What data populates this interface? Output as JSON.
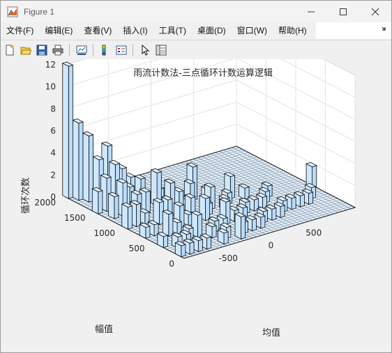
{
  "window": {
    "title": "Figure 1"
  },
  "menu": [
    "文件(F)",
    "编辑(E)",
    "查看(V)",
    "插入(I)",
    "工具(T)",
    "桌面(D)",
    "窗口(W)",
    "帮助(H)"
  ],
  "toolbar": {
    "buttons": [
      {
        "name": "new-figure-icon",
        "icon": "new-figure-icon"
      },
      {
        "name": "open-file-icon",
        "icon": "open-file-icon"
      },
      {
        "name": "save-icon",
        "icon": "save-icon"
      },
      {
        "name": "print-icon",
        "icon": "print-icon"
      },
      {
        "name": "link-plot-icon",
        "icon": "link-plot-icon"
      },
      {
        "name": "colorbar-icon",
        "icon": "colorbar-icon"
      },
      {
        "name": "legend-icon",
        "icon": "legend-icon"
      },
      {
        "name": "edit-plot-arrow-icon",
        "icon": "arrow-icon"
      },
      {
        "name": "property-inspector-icon",
        "icon": "property-inspector-icon"
      }
    ]
  },
  "colors": {
    "bar_face": "#cfe8ff",
    "bar_edge": "#0a0a0a",
    "axes_bg": "#ffffff",
    "grid": "#e3e3e3"
  },
  "chart_data": {
    "type": "bar3",
    "title": "雨流计数法-三点循环计数运算逻辑",
    "xlabel": "均值",
    "ylabel": "幅值",
    "zlabel": "循环次数",
    "xlim": [
      -1000,
      1000
    ],
    "ylim": [
      0,
      2000
    ],
    "zlim": [
      0,
      12
    ],
    "xticks": [
      -500,
      0,
      500
    ],
    "yticks": [
      0,
      500,
      1000,
      1500,
      2000
    ],
    "zticks": [
      0,
      2,
      4,
      6,
      8,
      10,
      12
    ],
    "grid": true,
    "bars": [
      {
        "x": -975,
        "y": 2000,
        "z": 12
      },
      {
        "x": -925,
        "y": 1900,
        "z": 7
      },
      {
        "x": -875,
        "y": 1800,
        "z": 6
      },
      {
        "x": -825,
        "y": 1700,
        "z": 4
      },
      {
        "x": -725,
        "y": 1700,
        "z": 5
      },
      {
        "x": -625,
        "y": 1600,
        "z": 3
      },
      {
        "x": -525,
        "y": 1600,
        "z": 2
      },
      {
        "x": -975,
        "y": 1500,
        "z": 2
      },
      {
        "x": -875,
        "y": 1500,
        "z": 3
      },
      {
        "x": -775,
        "y": 1500,
        "z": 4
      },
      {
        "x": -675,
        "y": 1400,
        "z": 2
      },
      {
        "x": -575,
        "y": 1400,
        "z": 1
      },
      {
        "x": -925,
        "y": 1300,
        "z": 2
      },
      {
        "x": -825,
        "y": 1300,
        "z": 3
      },
      {
        "x": -725,
        "y": 1200,
        "z": 2
      },
      {
        "x": -625,
        "y": 1200,
        "z": 2
      },
      {
        "x": -475,
        "y": 1500,
        "z": 2
      },
      {
        "x": -425,
        "y": 1300,
        "z": 3
      },
      {
        "x": -325,
        "y": 1400,
        "z": 1
      },
      {
        "x": -225,
        "y": 1300,
        "z": 1
      },
      {
        "x": -975,
        "y": 1000,
        "z": 2
      },
      {
        "x": -875,
        "y": 1000,
        "z": 2
      },
      {
        "x": -775,
        "y": 1000,
        "z": 1
      },
      {
        "x": -675,
        "y": 900,
        "z": 2
      },
      {
        "x": -575,
        "y": 900,
        "z": 2
      },
      {
        "x": -475,
        "y": 1000,
        "z": 3
      },
      {
        "x": -375,
        "y": 1000,
        "z": 2
      },
      {
        "x": -275,
        "y": 1000,
        "z": 1
      },
      {
        "x": -175,
        "y": 1100,
        "z": 2
      },
      {
        "x": -75,
        "y": 1200,
        "z": 3
      },
      {
        "x": 25,
        "y": 1100,
        "z": 1
      },
      {
        "x": -975,
        "y": 700,
        "z": 1
      },
      {
        "x": -875,
        "y": 700,
        "z": 1
      },
      {
        "x": -775,
        "y": 600,
        "z": 2
      },
      {
        "x": -675,
        "y": 600,
        "z": 1
      },
      {
        "x": -575,
        "y": 700,
        "z": 2
      },
      {
        "x": -475,
        "y": 700,
        "z": 1
      },
      {
        "x": -375,
        "y": 800,
        "z": 2
      },
      {
        "x": -275,
        "y": 700,
        "z": 2
      },
      {
        "x": -175,
        "y": 800,
        "z": 1
      },
      {
        "x": -75,
        "y": 900,
        "z": 2
      },
      {
        "x": 25,
        "y": 800,
        "z": 1
      },
      {
        "x": 125,
        "y": 900,
        "z": 1
      },
      {
        "x": 225,
        "y": 1000,
        "z": 2
      },
      {
        "x": 325,
        "y": 900,
        "z": 1
      },
      {
        "x": -975,
        "y": 400,
        "z": 1
      },
      {
        "x": -875,
        "y": 300,
        "z": 1
      },
      {
        "x": -775,
        "y": 300,
        "z": 1
      },
      {
        "x": -675,
        "y": 400,
        "z": 1
      },
      {
        "x": -575,
        "y": 400,
        "z": 2
      },
      {
        "x": -475,
        "y": 300,
        "z": 1
      },
      {
        "x": -375,
        "y": 400,
        "z": 1
      },
      {
        "x": -275,
        "y": 400,
        "z": 1
      },
      {
        "x": -175,
        "y": 500,
        "z": 2
      },
      {
        "x": -75,
        "y": 500,
        "z": 1
      },
      {
        "x": 25,
        "y": 500,
        "z": 1
      },
      {
        "x": 125,
        "y": 600,
        "z": 1
      },
      {
        "x": 225,
        "y": 600,
        "z": 1
      },
      {
        "x": 325,
        "y": 600,
        "z": 1
      },
      {
        "x": 425,
        "y": 700,
        "z": 1
      },
      {
        "x": 525,
        "y": 800,
        "z": 1
      },
      {
        "x": -975,
        "y": 100,
        "z": 1
      },
      {
        "x": -875,
        "y": 100,
        "z": 1
      },
      {
        "x": -775,
        "y": 100,
        "z": 1
      },
      {
        "x": -675,
        "y": 100,
        "z": 1
      },
      {
        "x": -475,
        "y": 100,
        "z": 1
      },
      {
        "x": -375,
        "y": 200,
        "z": 1
      },
      {
        "x": -275,
        "y": 100,
        "z": 2
      },
      {
        "x": -175,
        "y": 200,
        "z": 1
      },
      {
        "x": -75,
        "y": 200,
        "z": 1
      },
      {
        "x": 25,
        "y": 200,
        "z": 1
      },
      {
        "x": 125,
        "y": 300,
        "z": 1
      },
      {
        "x": 225,
        "y": 300,
        "z": 1
      },
      {
        "x": 325,
        "y": 300,
        "z": 1
      },
      {
        "x": 425,
        "y": 400,
        "z": 1
      },
      {
        "x": 525,
        "y": 400,
        "z": 1
      },
      {
        "x": 625,
        "y": 400,
        "z": 1
      },
      {
        "x": 725,
        "y": 400,
        "z": 1
      },
      {
        "x": 825,
        "y": 500,
        "z": 1
      },
      {
        "x": 975,
        "y": 700,
        "z": 2
      }
    ]
  }
}
